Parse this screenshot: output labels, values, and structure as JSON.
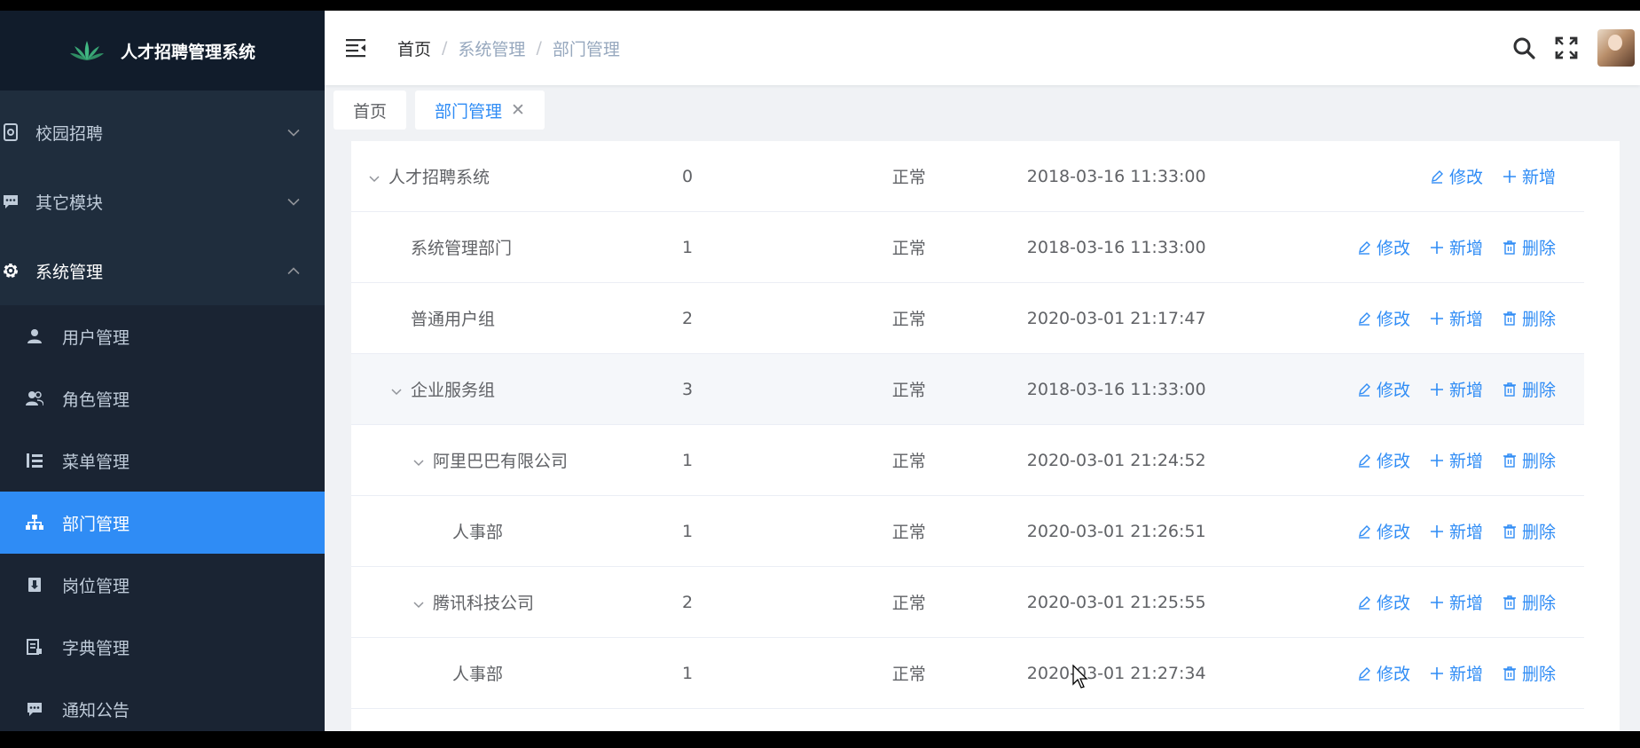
{
  "app": {
    "title": "人才招聘管理系统"
  },
  "sidebar": {
    "menus": [
      {
        "label": "校园招聘",
        "icon": "document-icon",
        "arrow": "chevron-down"
      },
      {
        "label": "其它模块",
        "icon": "message-icon",
        "arrow": "chevron-down"
      },
      {
        "label": "系统管理",
        "icon": "gear-icon",
        "arrow": "chevron-up"
      }
    ],
    "submenu": [
      {
        "label": "用户管理",
        "icon": "user-icon"
      },
      {
        "label": "角色管理",
        "icon": "peoples-icon"
      },
      {
        "label": "菜单管理",
        "icon": "tree-table-icon"
      },
      {
        "label": "部门管理",
        "icon": "org-tree-icon",
        "active": true
      },
      {
        "label": "岗位管理",
        "icon": "post-icon"
      },
      {
        "label": "字典管理",
        "icon": "dict-icon"
      },
      {
        "label": "通知公告",
        "icon": "message-icon"
      }
    ]
  },
  "breadcrumb": [
    "首页",
    "系统管理",
    "部门管理"
  ],
  "tags": [
    {
      "label": "首页"
    },
    {
      "label": "部门管理",
      "active": true,
      "close": "✕"
    }
  ],
  "ops": {
    "edit": "修改",
    "add": "新增",
    "delete": "删除"
  },
  "rows": [
    {
      "name": "人才招聘系统",
      "order": "0",
      "status": "正常",
      "time": "2018-03-16 11:33:00",
      "indent": 0,
      "caret": true,
      "delete": false
    },
    {
      "name": "系统管理部门",
      "order": "1",
      "status": "正常",
      "time": "2018-03-16 11:33:00",
      "indent": 1,
      "caret": false,
      "delete": true
    },
    {
      "name": "普通用户组",
      "order": "2",
      "status": "正常",
      "time": "2020-03-01 21:17:47",
      "indent": 1,
      "caret": false,
      "delete": true
    },
    {
      "name": "企业服务组",
      "order": "3",
      "status": "正常",
      "time": "2018-03-16 11:33:00",
      "indent": 1,
      "caret": true,
      "delete": true,
      "highlight": true
    },
    {
      "name": "阿里巴巴有限公司",
      "order": "1",
      "status": "正常",
      "time": "2020-03-01 21:24:52",
      "indent": 2,
      "caret": true,
      "delete": true
    },
    {
      "name": "人事部",
      "order": "1",
      "status": "正常",
      "time": "2020-03-01 21:26:51",
      "indent": 3,
      "caret": false,
      "delete": true
    },
    {
      "name": "腾讯科技公司",
      "order": "2",
      "status": "正常",
      "time": "2020-03-01 21:25:55",
      "indent": 2,
      "caret": true,
      "delete": true
    },
    {
      "name": "人事部",
      "order": "1",
      "status": "正常",
      "time": "2020-03-01 21:27:34",
      "indent": 3,
      "caret": false,
      "delete": true
    }
  ],
  "colors": {
    "sidebar": "#1f2d3d",
    "active": "#2f8cf5",
    "link": "#2f8cf5"
  }
}
